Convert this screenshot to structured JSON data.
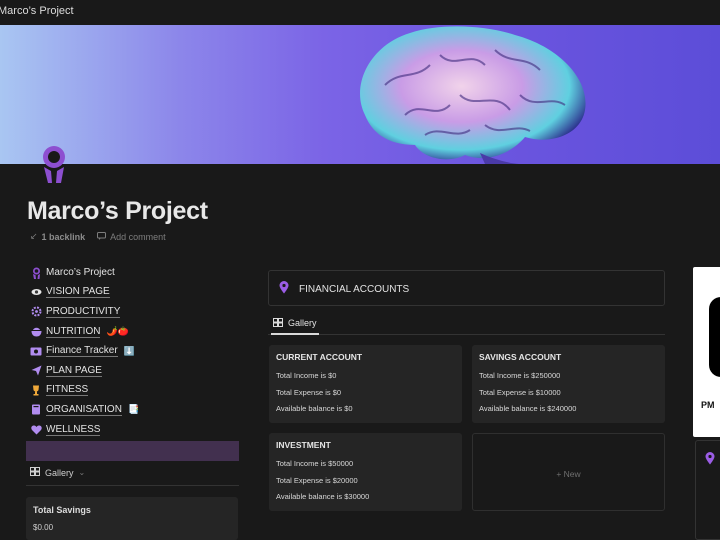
{
  "window": {
    "title": "Marco’s Project"
  },
  "page": {
    "title": "Marco’s Project",
    "backlink": "1 backlink",
    "add_comment": "Add comment"
  },
  "nav": {
    "items": [
      {
        "label": "Marco’s Project",
        "icon": "person-head-icon",
        "underline": false,
        "emoji": ""
      },
      {
        "label": "VISION PAGE",
        "icon": "eye-icon",
        "underline": true,
        "emoji": ""
      },
      {
        "label": "PRODUCTIVITY",
        "icon": "gear-icon",
        "underline": true,
        "emoji": ""
      },
      {
        "label": "NUTRITION",
        "icon": "bowl-icon",
        "underline": true,
        "emoji": "🌶️🍅"
      },
      {
        "label": "Finance Tracker",
        "icon": "money-icon",
        "underline": true,
        "emoji": "⬇️"
      },
      {
        "label": "PLAN PAGE",
        "icon": "paper-plane-icon",
        "underline": true,
        "emoji": ""
      },
      {
        "label": "FITNESS",
        "icon": "trophy-icon",
        "underline": true,
        "emoji": ""
      },
      {
        "label": "ORGANISATION",
        "icon": "book-icon",
        "underline": true,
        "emoji": "📑"
      },
      {
        "label": "WELLNESS",
        "icon": "heart-icon",
        "underline": true,
        "emoji": ""
      }
    ]
  },
  "sidebar_gallery": {
    "label": "Gallery"
  },
  "savings": {
    "title": "Total Savings",
    "value": "$0.00"
  },
  "financial": {
    "header": "FINANCIAL ACCOUNTS",
    "tab": "Gallery",
    "new_label": "New",
    "cards": [
      {
        "title": "CURRENT ACCOUNT",
        "lines": [
          "Total Income is $0",
          "Total Expense is $0",
          "Available balance is $0"
        ]
      },
      {
        "title": "SAVINGS ACCOUNT",
        "lines": [
          "Total Income is $250000",
          "Total Expense is $10000",
          "Available balance is $240000"
        ]
      },
      {
        "title": "INVESTMENT",
        "lines": [
          "Total Income is $50000",
          "Total Expense is $20000",
          "Available balance is $30000"
        ]
      }
    ]
  },
  "clock": {
    "period": "PM"
  },
  "colors": {
    "accent": "#9b5de5",
    "background": "#191919",
    "card": "#252525",
    "selection": "#42304f"
  }
}
